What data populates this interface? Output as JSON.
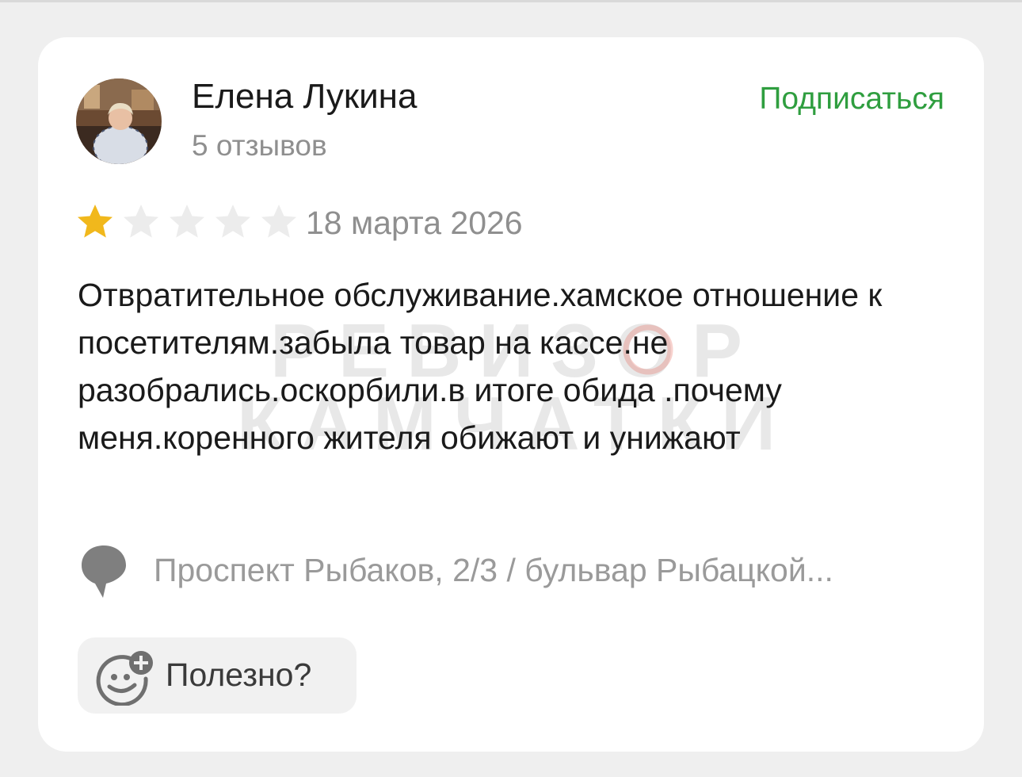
{
  "review": {
    "author": {
      "name": "Елена Лукина",
      "reviews_count": "5 отзывов"
    },
    "subscribe_label": "Подписаться",
    "rating": 1,
    "rating_max": 5,
    "date": "18 марта 2026",
    "text": "Отвратительное обслуживание.хамское отношение к посетителям.забыла товар на кассе.не разобрались.оскорбили.в итоге обида .почему меня.коренного жителя обижают и унижают",
    "address": "Проспект Рыбаков, 2/3 / бульвар Рыбацкой...",
    "helpful_label": "Полезно?"
  },
  "watermark": {
    "line1": "РЕВИЗОР",
    "line2": "КАМЧАТКИ"
  },
  "colors": {
    "accent_green": "#2f9e3f",
    "star_filled": "#f1b81c",
    "star_empty": "#ececec",
    "muted_text": "#8f8f8f",
    "card_bg": "#ffffff",
    "page_bg": "#efefef"
  },
  "icons": {
    "location": "map-pin-icon",
    "helpful": "smiley-plus-icon",
    "star": "star-icon"
  }
}
